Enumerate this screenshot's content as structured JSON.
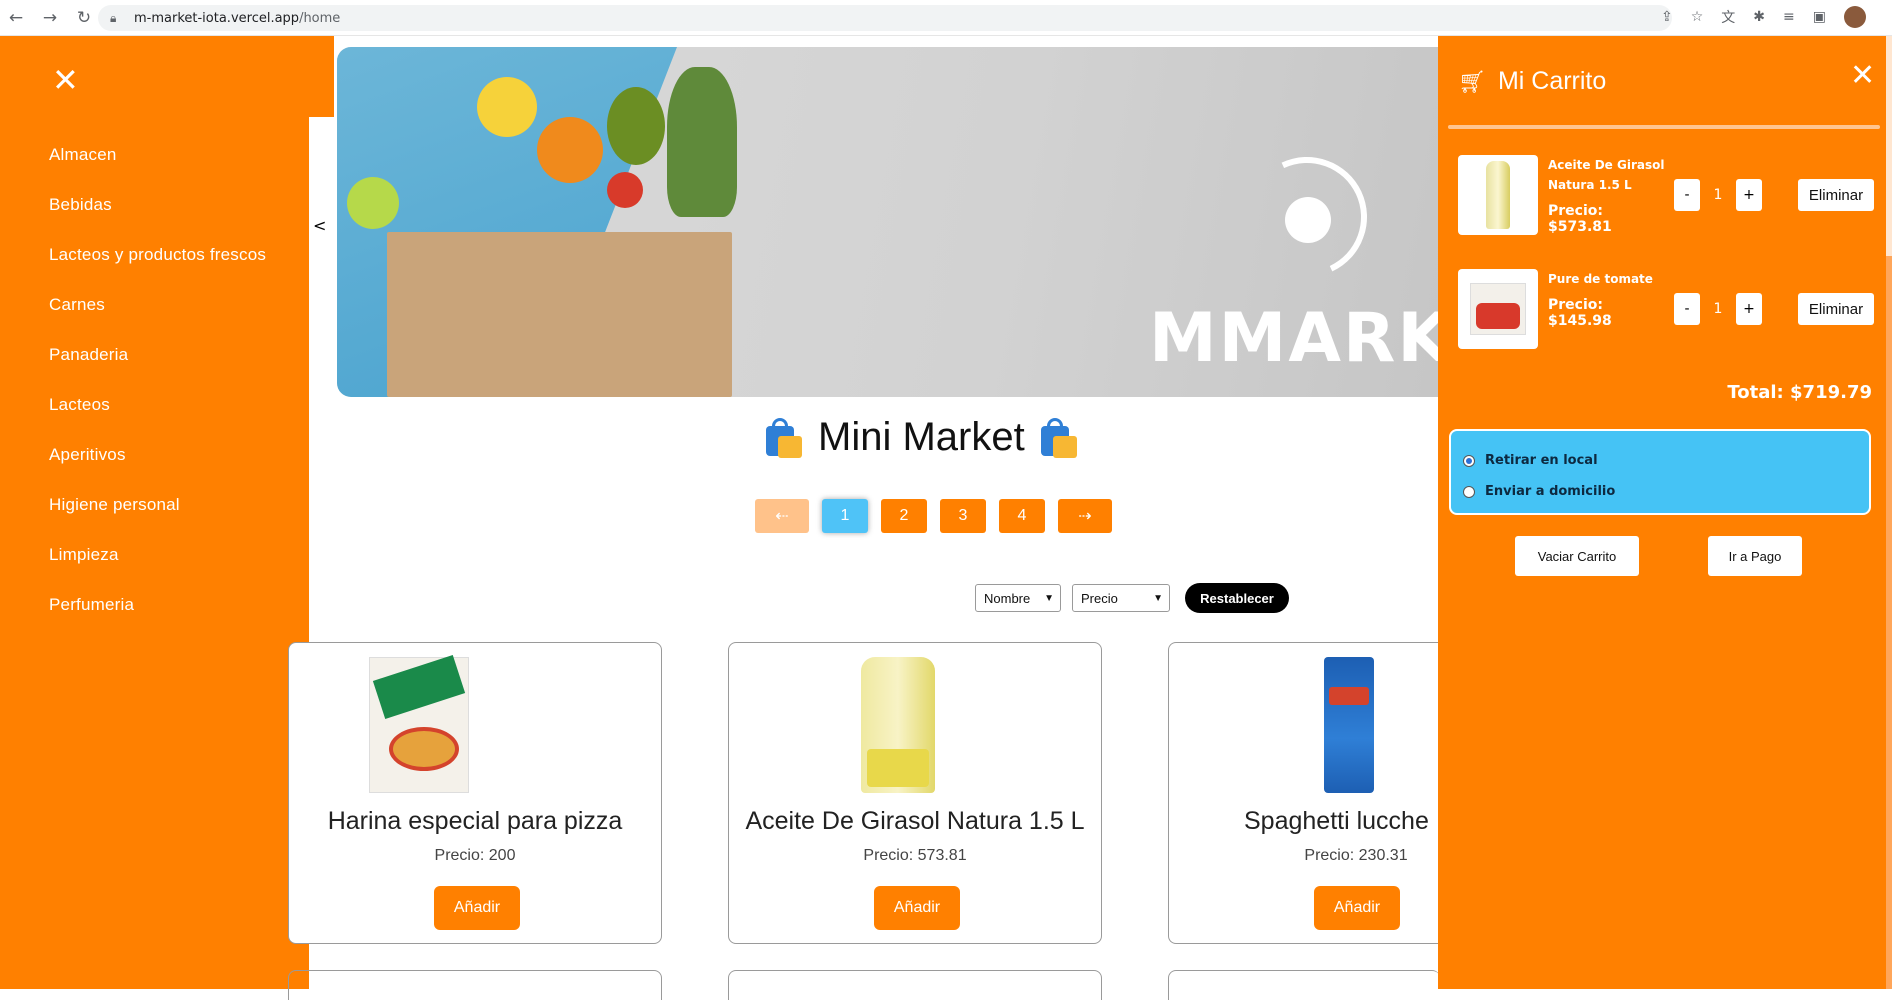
{
  "browser": {
    "url_host": "m-market-iota.vercel.app",
    "url_path": "/home"
  },
  "sidebar": {
    "items": [
      {
        "label": "Almacen"
      },
      {
        "label": "Bebidas"
      },
      {
        "label": "Lacteos y productos frescos"
      },
      {
        "label": "Carnes"
      },
      {
        "label": "Panaderia"
      },
      {
        "label": "Lacteos"
      },
      {
        "label": "Aperitivos"
      },
      {
        "label": "Higiene personal"
      },
      {
        "label": "Limpieza"
      },
      {
        "label": "Perfumeria"
      }
    ],
    "collapse_label": "<"
  },
  "banner": {
    "brand": "MMARKET"
  },
  "main": {
    "title": "Mini Market",
    "pager": {
      "prev": "⇠",
      "pages": [
        "1",
        "2",
        "3",
        "4"
      ],
      "active": "1",
      "next": "⇢"
    },
    "filters": {
      "sort_name": "Nombre",
      "sort_price": "Precio",
      "reset": "Restablecer"
    },
    "products": [
      {
        "name": "Harina especial para pizza",
        "price": "Precio: 200",
        "add": "Añadir"
      },
      {
        "name": "Aceite De Girasol Natura 1.5 L",
        "price": "Precio: 573.81",
        "add": "Añadir"
      },
      {
        "name": "Spaghetti lucche",
        "price": "Precio: 230.31",
        "add": "Añadir"
      }
    ]
  },
  "cart": {
    "title": "Mi Carrito",
    "items": [
      {
        "name": "Aceite De Girasol Natura 1.5 L",
        "price": "Precio: $573.81",
        "qty": "1",
        "remove": "Eliminar"
      },
      {
        "name": "Pure de tomate",
        "price": "Precio: $145.98",
        "qty": "1",
        "remove": "Eliminar"
      }
    ],
    "minus": "-",
    "plus": "+",
    "total": "Total: $719.79",
    "shipping": {
      "options": [
        "Retirar en local",
        "Enviar a domicilio"
      ],
      "selected": "Retirar en local"
    },
    "empty_button": "Vaciar Carrito",
    "pay_button": "Ir a Pago"
  },
  "colors": {
    "accent": "#ff8000",
    "active_page": "#4fc3f7",
    "shipping_box": "#45c3f5"
  }
}
